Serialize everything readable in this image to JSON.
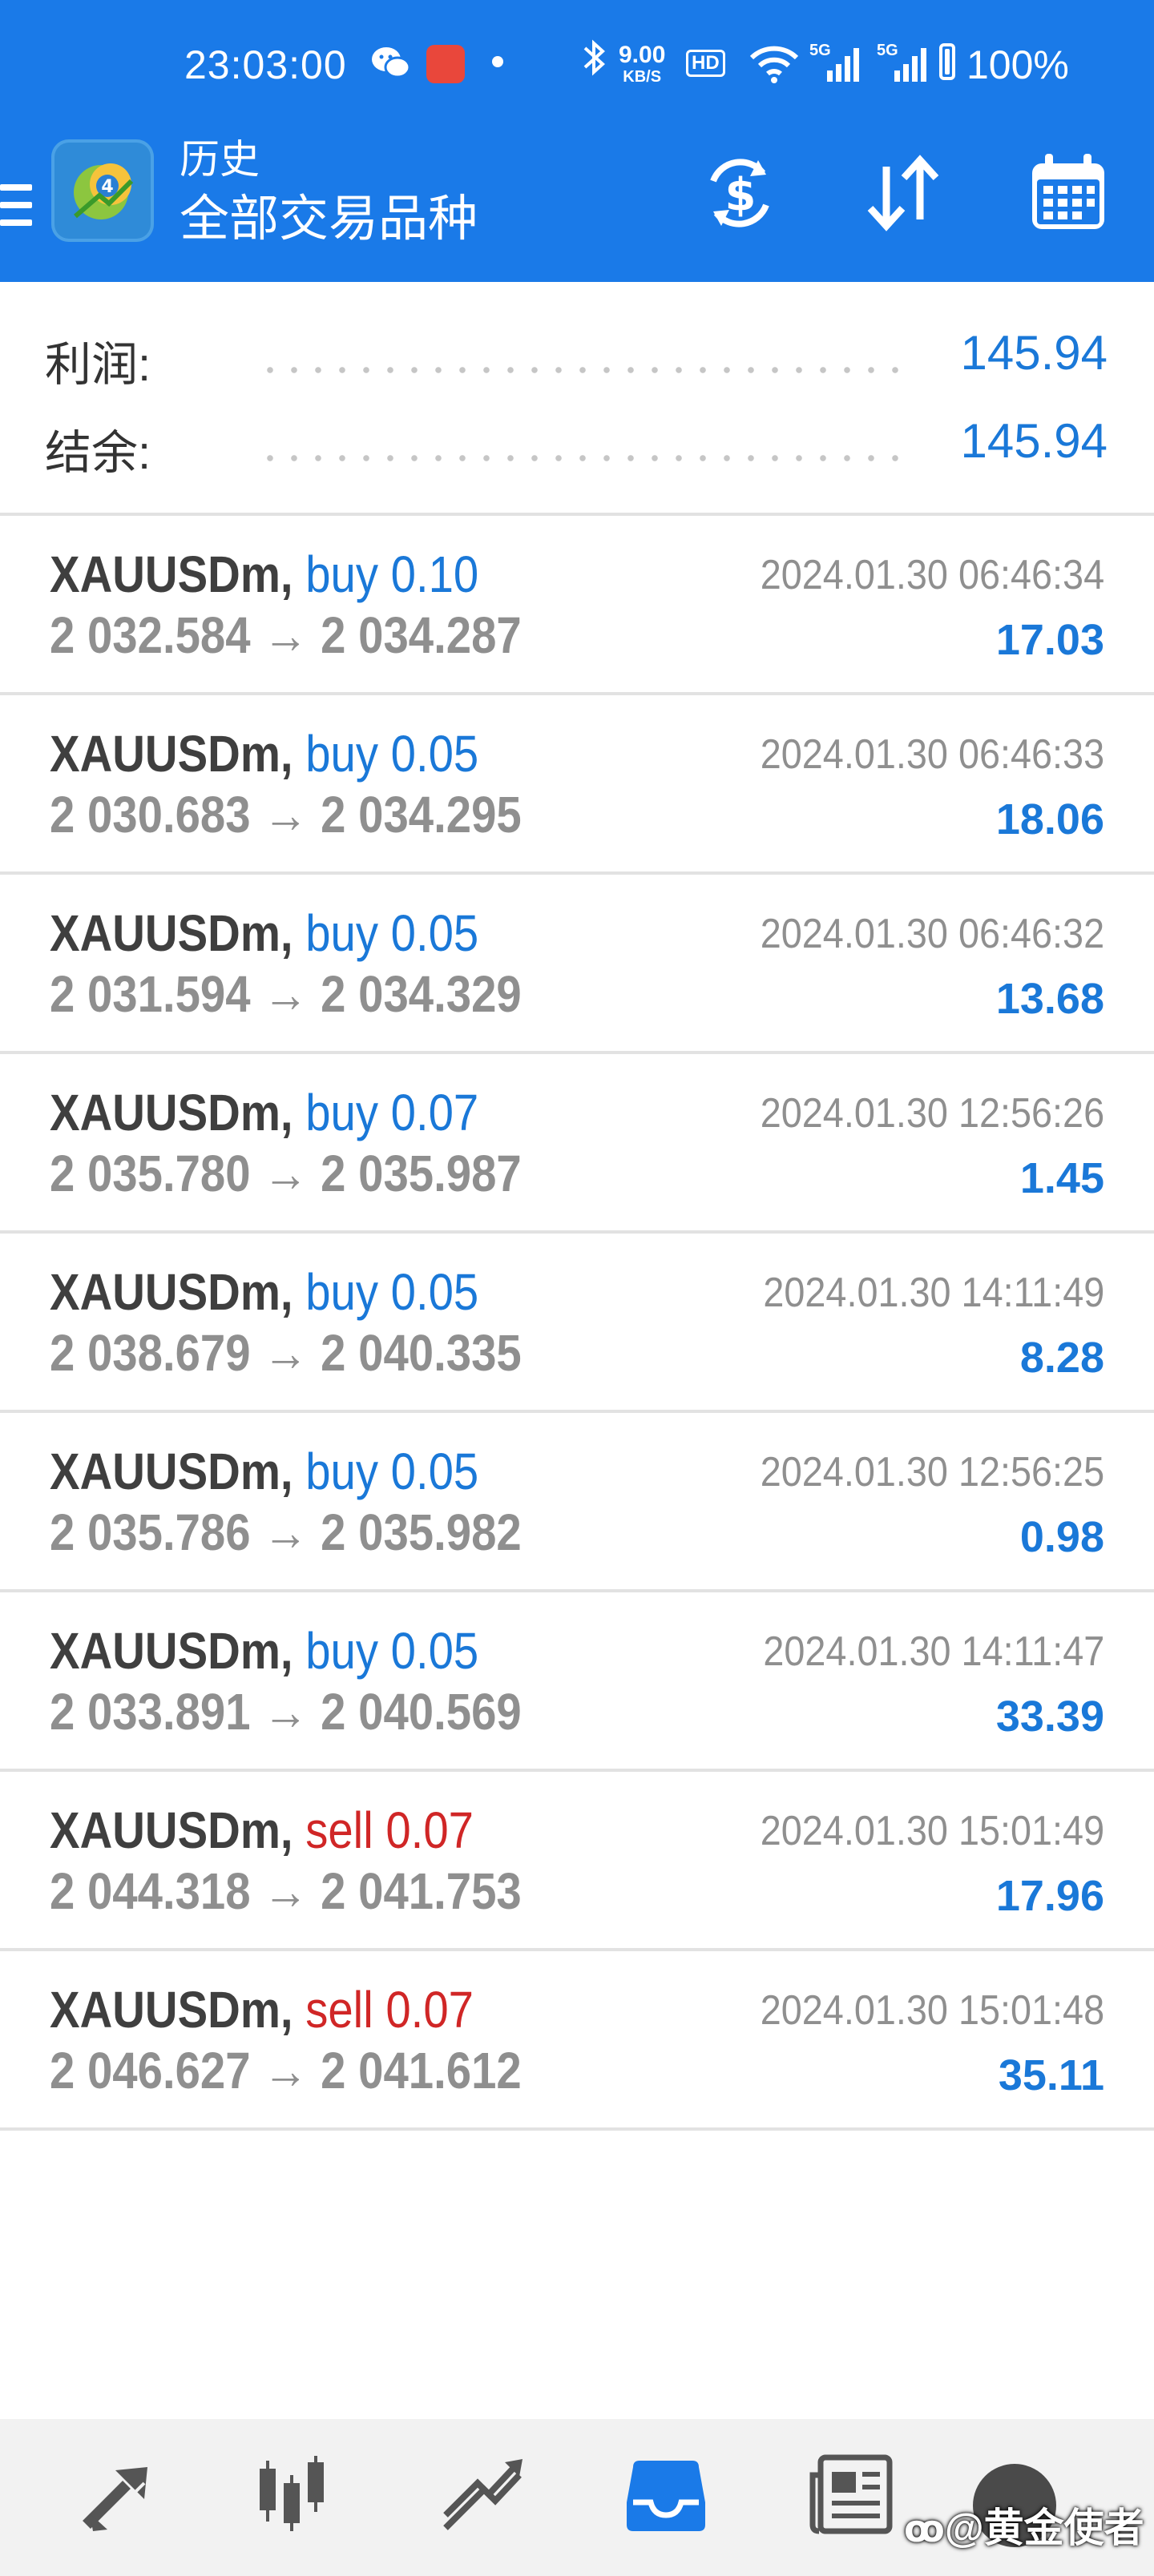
{
  "status_bar": {
    "time": "23:03:00",
    "net_speed_value": "9.00",
    "net_speed_unit": "KB/S",
    "hd_label": "HD",
    "signal1": "5G",
    "signal2": "5G",
    "battery": "100%"
  },
  "toolbar": {
    "title": "历史",
    "subtitle": "全部交易品种",
    "icons": [
      "currency-exchange-icon",
      "sort-icon",
      "calendar-icon"
    ]
  },
  "summary": {
    "profit_label": "利润:",
    "profit_value": "145.94",
    "balance_label": "结余:",
    "balance_value": "145.94"
  },
  "trades": [
    {
      "symbol": "XAUUSDm,",
      "side": "buy",
      "volume": "0.10",
      "open": "2 032.584",
      "arrow": "→",
      "close": "2 034.287",
      "time": "2024.01.30 06:46:34",
      "profit": "17.03"
    },
    {
      "symbol": "XAUUSDm,",
      "side": "buy",
      "volume": "0.05",
      "open": "2 030.683",
      "arrow": "→",
      "close": "2 034.295",
      "time": "2024.01.30 06:46:33",
      "profit": "18.06"
    },
    {
      "symbol": "XAUUSDm,",
      "side": "buy",
      "volume": "0.05",
      "open": "2 031.594",
      "arrow": "→",
      "close": "2 034.329",
      "time": "2024.01.30 06:46:32",
      "profit": "13.68"
    },
    {
      "symbol": "XAUUSDm,",
      "side": "buy",
      "volume": "0.07",
      "open": "2 035.780",
      "arrow": "→",
      "close": "2 035.987",
      "time": "2024.01.30 12:56:26",
      "profit": "1.45"
    },
    {
      "symbol": "XAUUSDm,",
      "side": "buy",
      "volume": "0.05",
      "open": "2 038.679",
      "arrow": "→",
      "close": "2 040.335",
      "time": "2024.01.30 14:11:49",
      "profit": "8.28"
    },
    {
      "symbol": "XAUUSDm,",
      "side": "buy",
      "volume": "0.05",
      "open": "2 035.786",
      "arrow": "→",
      "close": "2 035.982",
      "time": "2024.01.30 12:56:25",
      "profit": "0.98"
    },
    {
      "symbol": "XAUUSDm,",
      "side": "buy",
      "volume": "0.05",
      "open": "2 033.891",
      "arrow": "→",
      "close": "2 040.569",
      "time": "2024.01.30 14:11:47",
      "profit": "33.39"
    },
    {
      "symbol": "XAUUSDm,",
      "side": "sell",
      "volume": "0.07",
      "open": "2 044.318",
      "arrow": "→",
      "close": "2 041.753",
      "time": "2024.01.30 15:01:49",
      "profit": "17.96"
    },
    {
      "symbol": "XAUUSDm,",
      "side": "sell",
      "volume": "0.07",
      "open": "2 046.627",
      "arrow": "→",
      "close": "2 041.612",
      "time": "2024.01.30 15:01:48",
      "profit": "35.11"
    }
  ],
  "bottom_nav": {
    "items": [
      "quotes-icon",
      "chart-icon",
      "trade-icon",
      "history-icon",
      "news-icon",
      "more-icon"
    ],
    "active": "history-icon"
  },
  "watermark": "@黄金使者",
  "colors": {
    "brand": "#1a7ae8",
    "buy": "#1a78d8",
    "sell": "#d02626",
    "profit": "#1a78d8",
    "price": "#8f8f8f",
    "symbol": "#3f3f3f"
  }
}
